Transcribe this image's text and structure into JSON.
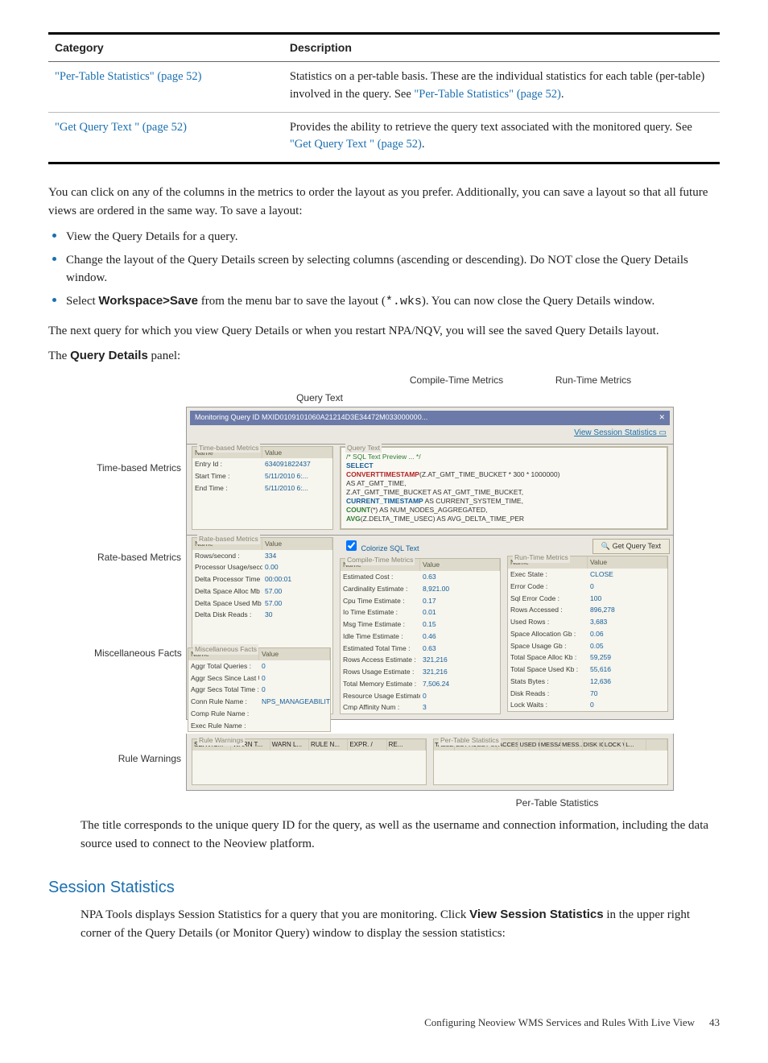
{
  "table": {
    "h_cat": "Category",
    "h_desc": "Description",
    "rows": [
      {
        "cat_l": "\"Per-Table Statistics\" (page 52)",
        "desc_a": "Statistics on a per-table basis. These are the individual statistics for each table (per-table) involved in the query. See ",
        "desc_l": "\"Per-Table Statistics\" (page 52)",
        "desc_b": "."
      },
      {
        "cat_l": "\"Get Query Text \" (page 52)",
        "desc_a": "Provides the ability to retrieve the query text associated with the monitored query. See ",
        "desc_l": "\"Get Query Text \" (page 52)",
        "desc_b": "."
      }
    ]
  },
  "para1": "You can click on any of the columns in the metrics to order the layout as you prefer. Additionally, you can save a layout so that all future views are ordered in the same way. To save a layout:",
  "bul": {
    "b1": "View the Query Details for a query.",
    "b2": "Change the layout of the Query Details screen by selecting columns (ascending or descending). Do NOT close the Query Details window.",
    "b3a": "Select ",
    "b3b": "Workspace>Save",
    "b3c": " from the menu bar to save the layout (",
    "b3d": "*.wks",
    "b3e": "). You can now close the Query Details window."
  },
  "para2": "The next query for which you view Query Details or when you restart NPA/NQV, you will see the saved Query Details layout.",
  "para3a": "The ",
  "para3b": "Query Details",
  "para3c": " panel:",
  "fig": {
    "call_ct": "Compile-Time Metrics",
    "call_rt": "Run-Time Metrics",
    "call_qt": "Query Text",
    "side_tb": "Time-based Metrics",
    "side_rb": "Rate-based Metrics",
    "side_mf": "Miscellaneous Facts",
    "side_rw": "Rule Warnings",
    "title_bar": "Monitoring Query ID MXID0109101060A21214D3E34472M033000000...",
    "view_sess": "View Session Statistics",
    "qt_title": "Query Text",
    "qt_prev": "/*  SQL Text Preview ...  */",
    "sql": {
      "l1": "SELECT",
      "l2a": "CONVERTTIMESTAMP",
      "l2b": "(Z.AT_GMT_TIME_BUCKET * 300 * 1000000)",
      "l3": "AS AT_GMT_TIME,",
      "l4": "Z.AT_GMT_TIME_BUCKET AS AT_GMT_TIME_BUCKET,",
      "l5a": "CURRENT_TIMESTAMP",
      "l5b": " AS CURRENT_SYSTEM_TIME,",
      "l6a": "COUNT",
      "l6b": "(*) AS NUM_NODES_AGGREGATED,",
      "l7a": "AVG",
      "l7b": "(Z.DELTA_TIME_USEC) AS AVG_DELTA_TIME_PER"
    },
    "colorize_cb": "Colorize SQL Text",
    "get_q_btn": "Get Query Text",
    "tb": {
      "title": "Time-based Metrics",
      "h1": "Name",
      "h2": "Value",
      "r": [
        [
          "Entry Id :",
          "634091822437"
        ],
        [
          "Start Time :",
          "5/11/2010 6:..."
        ],
        [
          "End Time :",
          "5/11/2010 6:..."
        ]
      ]
    },
    "rb": {
      "title": "Rate-based Metrics",
      "h1": "Name",
      "h2": "Value",
      "r": [
        [
          "Rows/second :",
          "334"
        ],
        [
          "Processor Usage/second :",
          "0.00"
        ],
        [
          "Delta Processor Time :",
          "00:00:01"
        ],
        [
          "Delta Space Alloc Mb :",
          "57.00"
        ],
        [
          "Delta Space Used Mb :",
          "57.00"
        ],
        [
          "Delta Disk Reads :",
          "30"
        ]
      ]
    },
    "mf": {
      "title": "Miscellaneous Facts",
      "h1": "Name",
      "h2": "Value",
      "r": [
        [
          "Aggr Total Queries :",
          "0"
        ],
        [
          "Aggr Secs Since Last Update :",
          "0"
        ],
        [
          "Aggr Secs Total Time :",
          "0"
        ],
        [
          "Conn Rule Name :",
          "NPS_MANAGEABILITY"
        ],
        [
          "Comp Rule Name :",
          ""
        ],
        [
          "Exec Rule Name :",
          ""
        ]
      ]
    },
    "ct": {
      "title": "Compile-Time Metrics",
      "h1": "Name",
      "h2": "Value",
      "r": [
        [
          "Estimated Cost :",
          "0.63"
        ],
        [
          "Cardinality Estimate :",
          "8,921.00"
        ],
        [
          "Cpu Time Estimate :",
          "0.17"
        ],
        [
          "Io Time Estimate :",
          "0.01"
        ],
        [
          "Msg Time Estimate :",
          "0.15"
        ],
        [
          "Idle Time Estimate :",
          "0.46"
        ],
        [
          "Estimated Total Time :",
          "0.63"
        ],
        [
          "Rows Access Estimate :",
          "321,216"
        ],
        [
          "Rows Usage Estimate :",
          "321,216"
        ],
        [
          "Total Memory Estimate :",
          "7,506.24"
        ],
        [
          "Resource Usage Estimate :",
          "0"
        ],
        [
          "Cmp Affinity Num :",
          "3"
        ]
      ]
    },
    "rt": {
      "title": "Run-Time Metrics",
      "h1": "Name",
      "h2": "Value",
      "r": [
        [
          "Exec State :",
          "CLOSE"
        ],
        [
          "Error Code :",
          "0"
        ],
        [
          "Sql Error Code :",
          "100"
        ],
        [
          "Rows Accessed :",
          "896,278"
        ],
        [
          "Used Rows :",
          "3,683"
        ],
        [
          "Space Allocation Gb :",
          "0.06"
        ],
        [
          "Space Usage Gb :",
          "0.05"
        ],
        [
          "Total Space Alloc Kb :",
          "59,259"
        ],
        [
          "Total Space Used Kb :",
          "55,616"
        ],
        [
          "Stats Bytes :",
          "12,636"
        ],
        [
          "Disk Reads :",
          "70"
        ],
        [
          "Lock Waits :",
          "0"
        ]
      ]
    },
    "rw": {
      "title": "Rule Warnings",
      "cols": [
        "SERVIC...",
        "WARN T...",
        "WARN L...",
        "RULE N...",
        "EXPR. /",
        "RE..."
      ]
    },
    "pt": {
      "title": "Per-Table Statistics",
      "cols": [
        "TABLE...",
        "EST AC...",
        "EST US...",
        "ACCESS...",
        "USED R...",
        "MESSA...",
        "MESS... /",
        "DISK IOS",
        "LOCK W...",
        "L..."
      ]
    },
    "call_pt": "Per-Table Statistics"
  },
  "para4": "The title corresponds to the unique query ID for the query, as well as the username and connection information, including the data source used to connect to the Neoview platform.",
  "sec": "Session Statistics",
  "para5a": "NPA Tools displays Session Statistics for a query that you are monitoring. Click ",
  "para5b": "View Session Statistics",
  "para5c": " in the upper right corner of the Query Details (or Monitor Query) window to display the session statistics:",
  "footer_t": "Configuring Neoview WMS Services and Rules With Live View",
  "footer_p": "43"
}
